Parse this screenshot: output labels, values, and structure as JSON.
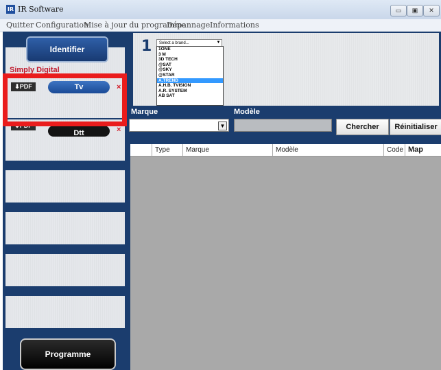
{
  "window": {
    "app_icon": "IR",
    "title": "IR Software",
    "buttons": {
      "minimize": "▭",
      "maximize": "▣",
      "close": "✕"
    }
  },
  "menu": {
    "items": [
      "Quitter",
      "Configuration",
      "Mise à jour du programme",
      "Dépannage",
      "Informations"
    ]
  },
  "sidebar": {
    "identify_label": "Identifier",
    "device_name": "Simply  Digital",
    "pdf_badge": "⬇PDF",
    "tv_label": "Tv",
    "dtt_label": "Dtt",
    "remove_icon": "×",
    "program_label": "Programme"
  },
  "step": {
    "number": "1",
    "brand_select_placeholder": "Select a brand...",
    "brand_options": [
      "1ONE",
      "3 M",
      "3D TECH",
      "@SAT",
      "@SKY",
      "@STAR",
      "A.TREND",
      "A.H.B. TVISION",
      "A.R. SYSTEM",
      "AB SAT"
    ],
    "selected_brand": "A.TREND"
  },
  "filters": {
    "marque_label": "Marque",
    "modele_label": "Modèle",
    "marque_value": "",
    "modele_value": "",
    "search_button": "Chercher",
    "reset_button": "Réinitialiser"
  },
  "results_table": {
    "columns": [
      "",
      "Type",
      "Marque",
      "Modèle",
      "Code",
      "Map"
    ],
    "rows": []
  },
  "colors": {
    "accent": "#1b3d6e",
    "highlight": "#ea1c1c",
    "device_name": "#c0182b",
    "selection": "#3399ff"
  }
}
